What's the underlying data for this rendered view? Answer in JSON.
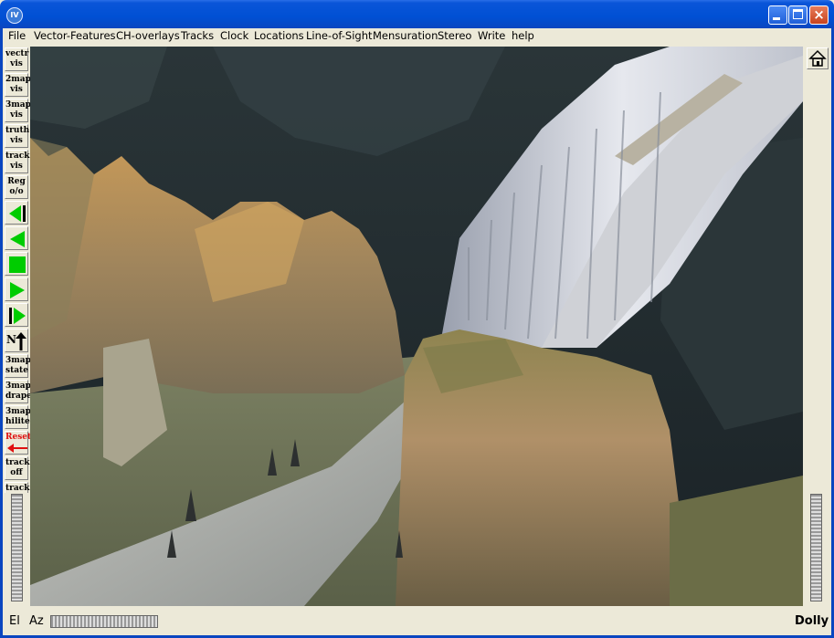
{
  "window": {
    "icon_text": "IV"
  },
  "menu": [
    "File",
    "Vector-Features",
    "CH-overlays",
    "Tracks",
    "Clock",
    "Locations",
    "Line-of-Sight",
    "Mensuration",
    "Stereo",
    "Write",
    "help"
  ],
  "toolbar": {
    "vectr_vis": [
      "vectr",
      "vis"
    ],
    "twomap_vis": [
      "2map",
      "vis"
    ],
    "threemap_vis": [
      "3map",
      "vis"
    ],
    "truth_vis": [
      "truth",
      "vis"
    ],
    "track_vis": [
      "track",
      "vis"
    ],
    "reg_oo": [
      "Reg",
      "o/o"
    ],
    "north_label": "N",
    "threemap_state": [
      "3map",
      "state"
    ],
    "threemap_drape": [
      "3map",
      "drape"
    ],
    "threemap_hilite": [
      "3map",
      "hilite"
    ],
    "reset_label": "Reset",
    "track_off": [
      "track",
      "off"
    ],
    "track_last": "track"
  },
  "bottom": {
    "el_label": "El",
    "az_label": "Az",
    "dolly_label": "Dolly"
  },
  "colors": {
    "titlebar": "#0a55d8",
    "play_green": "#00cc00",
    "reset_arrow": "#e01010",
    "window_bg": "#ece9d8"
  },
  "icons": {
    "rewind_to_start": "step-back-icon",
    "play_reverse": "play-reverse-icon",
    "stop": "stop-icon",
    "play": "play-icon",
    "step_forward": "step-forward-icon",
    "north_arrow": "north-arrow-icon",
    "home": "home-icon"
  }
}
